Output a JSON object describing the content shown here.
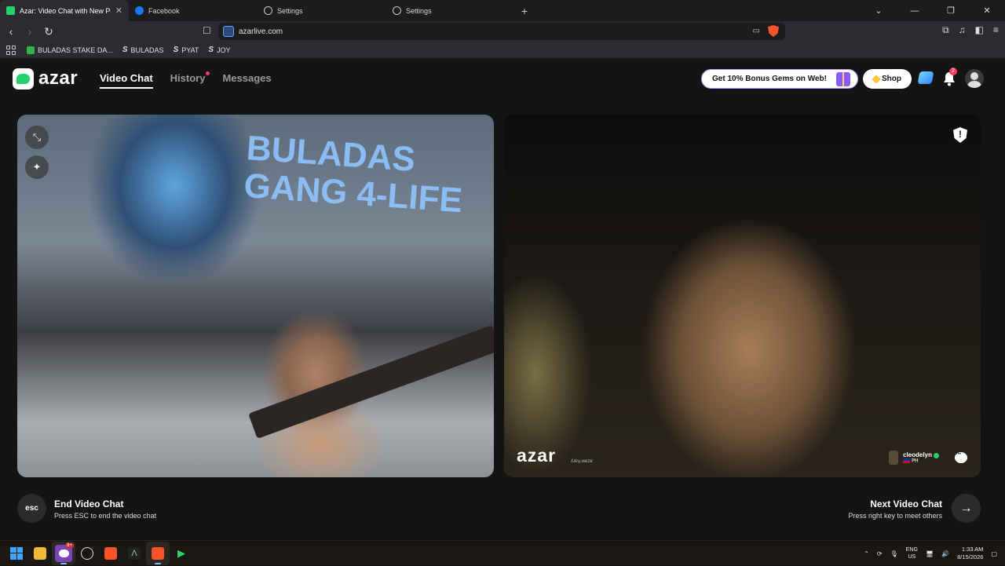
{
  "browser": {
    "tabs": [
      {
        "title": "Azar: Video Chat with New Pe",
        "active": true
      },
      {
        "title": "Facebook",
        "active": false
      },
      {
        "title": "Settings",
        "active": false
      },
      {
        "title": "Settings",
        "active": false
      }
    ],
    "url": "azarlive.com",
    "bookmarks": [
      "BULADAS STAKE DA...",
      "BULADAS",
      "PYAT",
      "JOY"
    ]
  },
  "azar": {
    "logo_text": "azar",
    "nav": {
      "video_chat": "Video Chat",
      "history": "History",
      "messages": "Messages"
    },
    "promo": "Get 10% Bonus Gems on Web!",
    "shop": "Shop",
    "notification_count": "2",
    "local_video": {
      "poster_text": "BULADAS GANG 4-LIFE"
    },
    "remote_video": {
      "watermark": "azar",
      "watermark_id": "ʎɹɐɥ-ʍɐzɐ",
      "peer_name": "cleodelyn",
      "peer_country": "PH"
    },
    "end": {
      "key": "esc",
      "title": "End Video Chat",
      "subtitle": "Press ESC to end the video chat"
    },
    "next": {
      "title": "Next Video Chat",
      "subtitle": "Press right key to meet others"
    }
  },
  "taskbar": {
    "discord_badge": "9+",
    "lang": "ENG",
    "region": "US",
    "time": "1:33 AM",
    "date": "8/15/2026"
  },
  "colors": {
    "accent_green": "#22d36a",
    "notification_red": "#ff3b5c",
    "promo_border": "#b59cff"
  }
}
